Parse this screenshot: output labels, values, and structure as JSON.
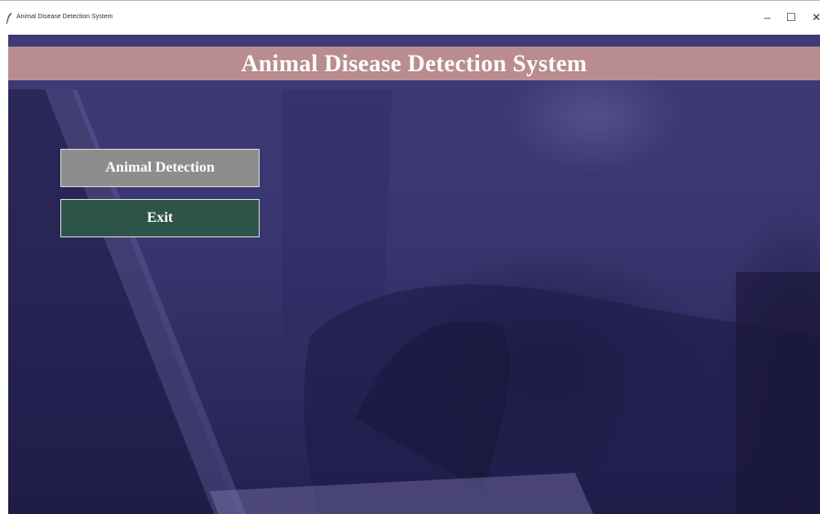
{
  "window": {
    "title": "Animal Disease Detection System",
    "controls": {
      "minimize": "–",
      "maximize": "☐",
      "close": "✕"
    }
  },
  "header": {
    "title": "Animal Disease Detection System"
  },
  "menu": {
    "detection_button": "Animal Detection",
    "exit_button": "Exit"
  },
  "colors": {
    "header_bar": "#b98d8f",
    "detection_button": "#8d8d8d",
    "exit_button": "#2e5448",
    "background": "#3a3670"
  }
}
